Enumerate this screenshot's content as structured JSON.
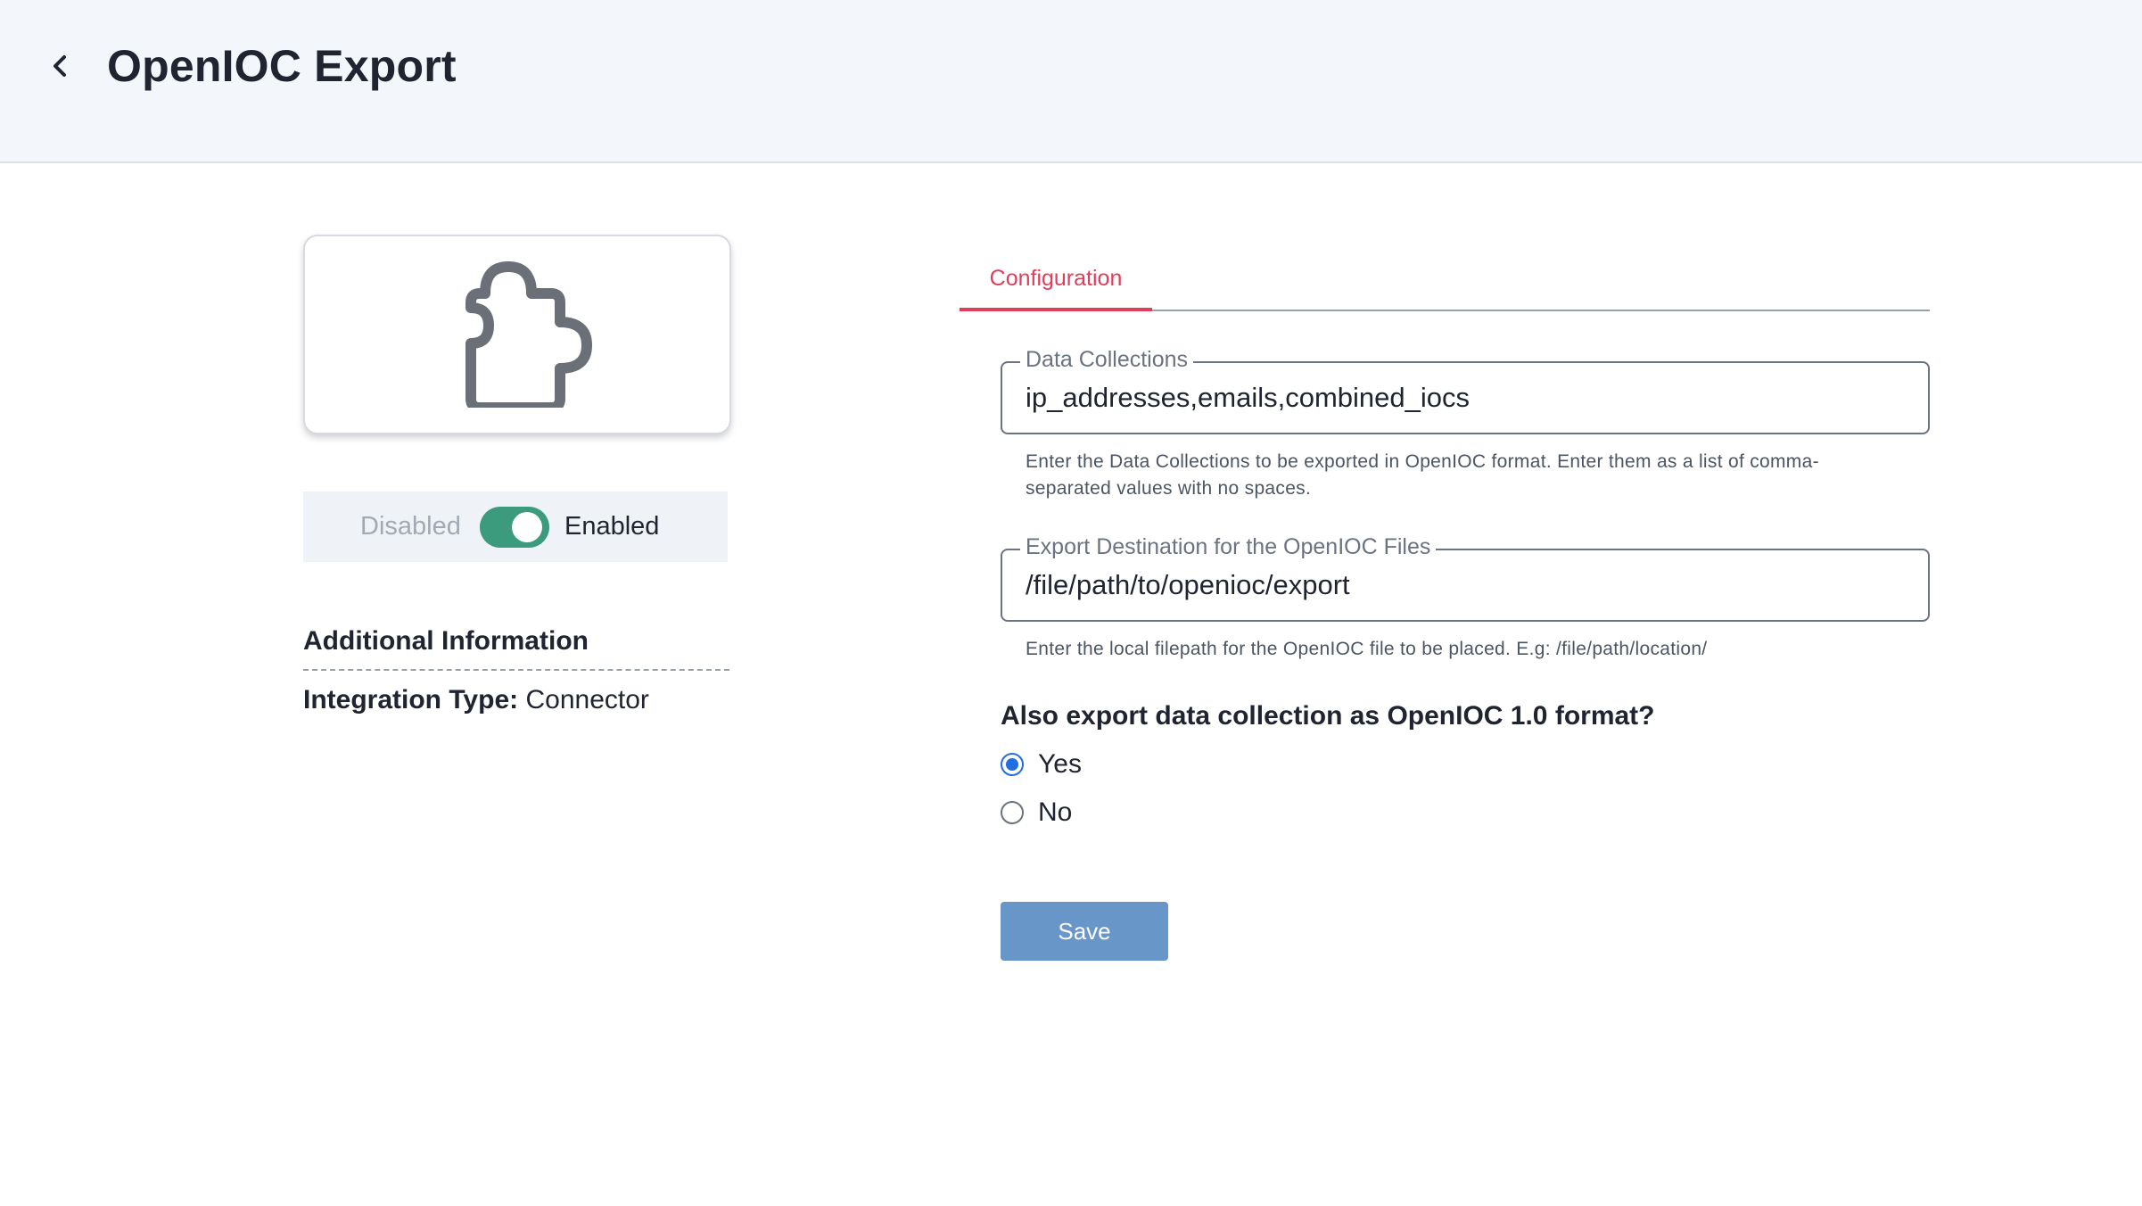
{
  "header": {
    "back_icon": "chevron-left-icon",
    "title": "OpenIOC Export"
  },
  "integration": {
    "logo_icon": "puzzle-piece-icon",
    "toggle": {
      "off_label": "Disabled",
      "on_label": "Enabled",
      "enabled": true,
      "color": "#3b9b7c"
    },
    "additional_info": {
      "heading": "Additional Information",
      "type_key": "Integration Type:",
      "type_value": "Connector"
    }
  },
  "tabs": [
    {
      "label": "Configuration",
      "active": true,
      "color": "#e23d5a"
    }
  ],
  "form": {
    "data_collections": {
      "label": "Data Collections",
      "value": "ip_addresses,emails,combined_iocs",
      "help": "Enter the Data Collections to be exported in OpenIOC format. Enter them as a list of comma-separated values with no spaces."
    },
    "export_destination": {
      "label": "Export Destination for the OpenIOC Files",
      "value": "/file/path/to/openioc/export",
      "help": "Enter the local filepath for the OpenIOC file to be placed. E.g: /file/path/location/"
    },
    "openioc_1_0": {
      "question": "Also export data collection as OpenIOC 1.0 format?",
      "options": [
        {
          "label": "Yes",
          "selected": true
        },
        {
          "label": "No",
          "selected": false
        }
      ]
    },
    "save_label": "Save",
    "save_color": "#6996c9"
  }
}
